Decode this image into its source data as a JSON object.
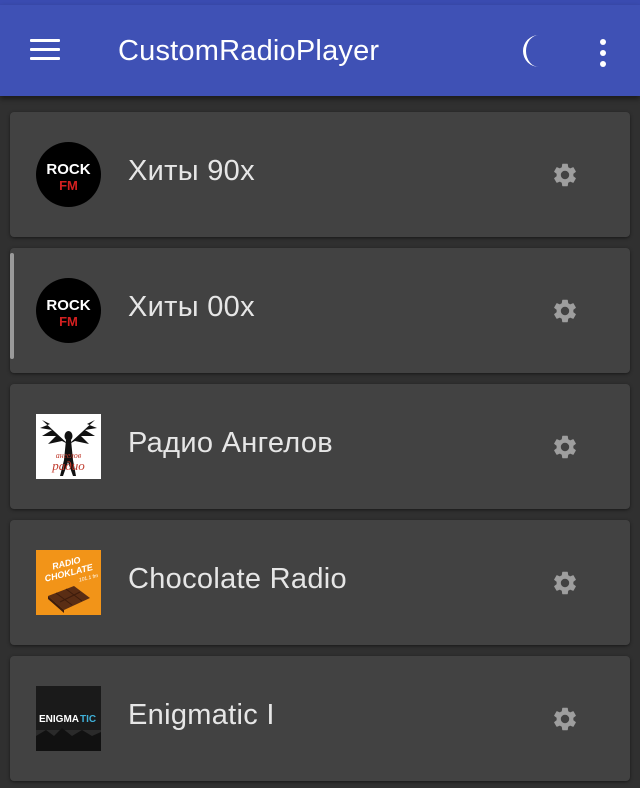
{
  "app": {
    "title": "CustomRadioPlayer",
    "colors": {
      "appbar": "#3f51b5",
      "background": "#303030",
      "card": "#424242",
      "text": "#e6e6e6",
      "icon": "#9e9e9e"
    }
  },
  "toolbar": {
    "menu_icon": "hamburger-menu-icon",
    "theme_icon": "moon-icon",
    "more_icon": "more-vertical-icon"
  },
  "stations": [
    {
      "name": "Хиты 90х",
      "logo": "rock-fm-logo",
      "logo_text": [
        "ROCK",
        "FM"
      ],
      "settings_icon": "gear-icon"
    },
    {
      "name": "Хиты 00х",
      "logo": "rock-fm-logo",
      "logo_text": [
        "ROCK",
        "FM"
      ],
      "settings_icon": "gear-icon"
    },
    {
      "name": "Радио Ангелов",
      "logo": "radio-angelov-logo",
      "logo_text": [
        "ангелов",
        "радио"
      ],
      "settings_icon": "gear-icon"
    },
    {
      "name": "Chocolate Radio",
      "logo": "chocolate-radio-logo",
      "logo_text": [
        "RADIO",
        "CHOKLATE",
        "101.1 fm"
      ],
      "settings_icon": "gear-icon"
    },
    {
      "name": "Enigmatic I",
      "logo": "enigmatic-logo",
      "logo_text": [
        "ENIGMA",
        "TIC"
      ],
      "settings_icon": "gear-icon"
    }
  ]
}
